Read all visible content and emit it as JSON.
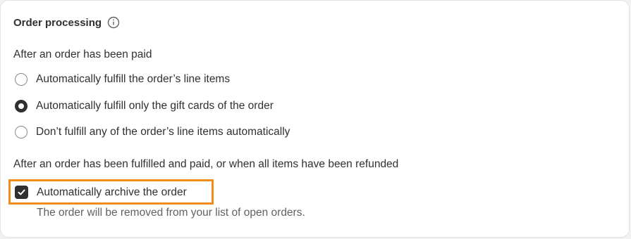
{
  "section": {
    "title": "Order processing",
    "info_icon": "info-circle-icon"
  },
  "paid_group": {
    "label": "After an order has been paid",
    "options": [
      {
        "label": "Automatically fulfill the order’s line items",
        "selected": false
      },
      {
        "label": "Automatically fulfill only the gift cards of the order",
        "selected": true
      },
      {
        "label": "Don’t fulfill any of the order’s line items automatically",
        "selected": false
      }
    ]
  },
  "archive_group": {
    "label": "After an order has been fulfilled and paid, or when all items have been refunded",
    "checkbox_label": "Automatically archive the order",
    "checked": true,
    "help_text": "The order will be removed from your list of open orders."
  },
  "colors": {
    "highlight": "#f08c1a",
    "control_dark": "#303030",
    "muted_text": "#616161"
  }
}
